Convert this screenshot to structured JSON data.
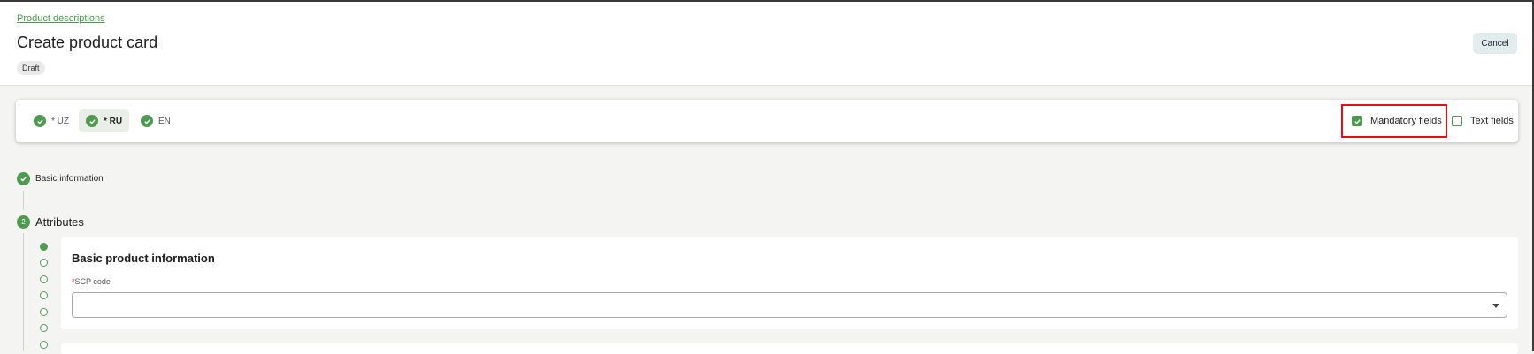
{
  "header": {
    "breadcrumb": "Product descriptions",
    "title": "Create product card",
    "status_badge": "Draft",
    "cancel_label": "Cancel"
  },
  "languages": [
    {
      "label": "* UZ",
      "active": false
    },
    {
      "label": "* RU",
      "active": true
    },
    {
      "label": "EN",
      "active": false
    }
  ],
  "filters": {
    "mandatory_fields": {
      "label": "Mandatory fields",
      "checked": true
    },
    "text_fields": {
      "label": "Text fields",
      "checked": false
    }
  },
  "steps": {
    "basic_information": "Basic information",
    "attributes_number": "2",
    "attributes": "Attributes"
  },
  "section": {
    "title": "Basic product information",
    "scp_label": "SCP code",
    "required_mark": "*",
    "scp_value": ""
  },
  "colors": {
    "accent": "#4e9a50",
    "highlight": "#e0101a"
  }
}
